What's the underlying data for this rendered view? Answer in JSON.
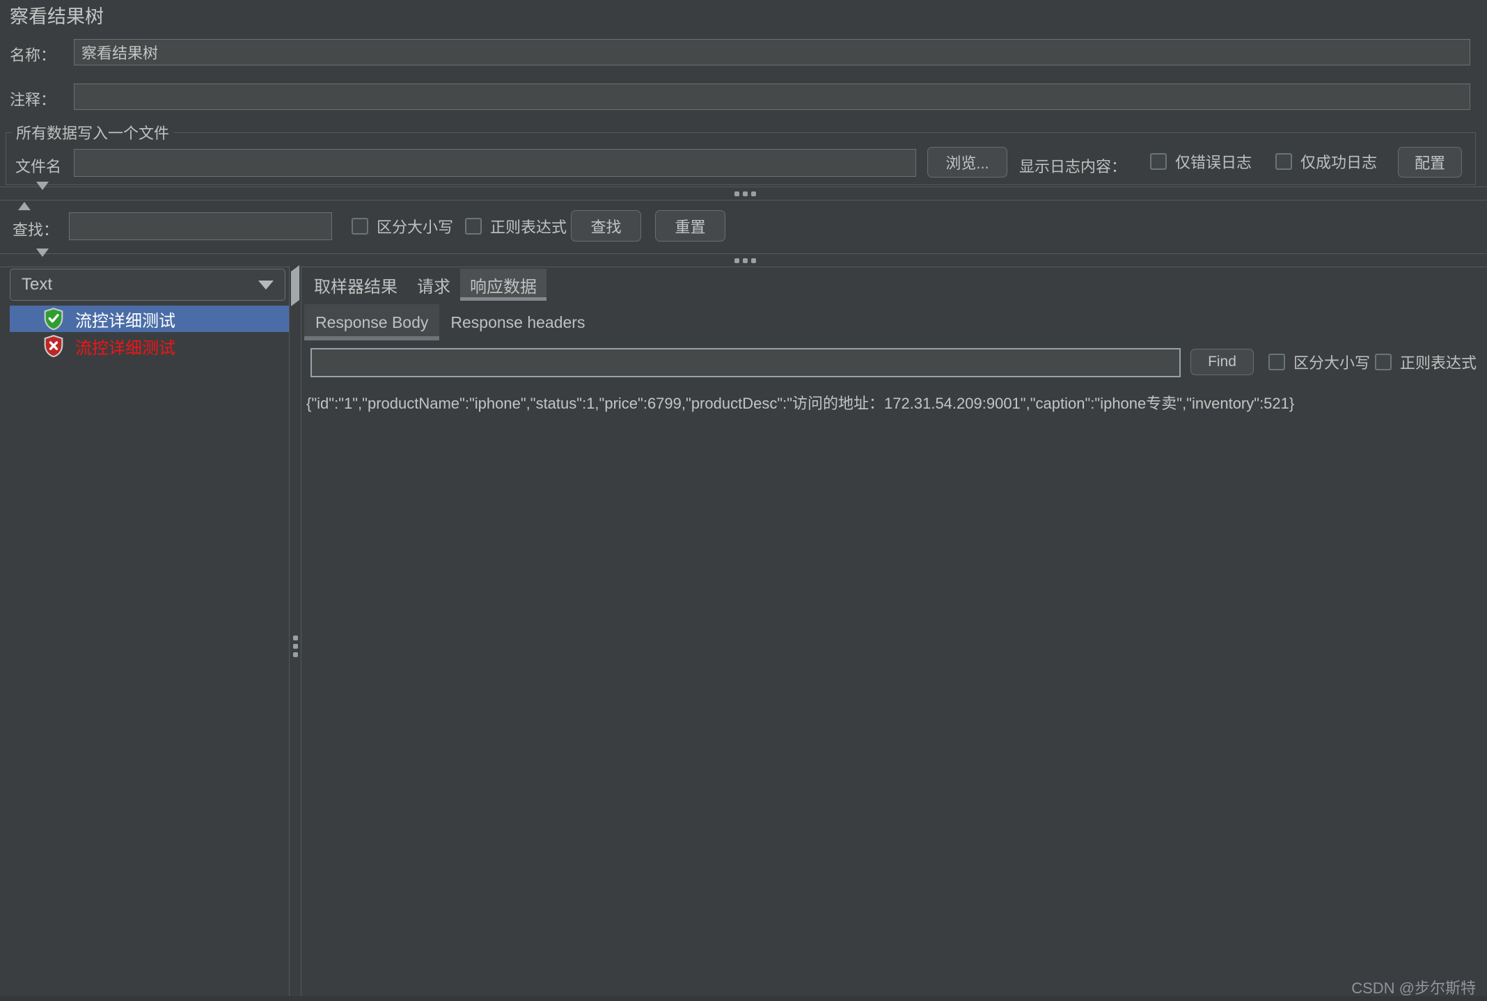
{
  "window": {
    "title": "察看结果树"
  },
  "form": {
    "name_label": "名称：",
    "name_value": "察看结果树",
    "comment_label": "注释：",
    "comment_value": "",
    "file_group": {
      "legend": "所有数据写入一个文件",
      "filename_label": "文件名",
      "filename_value": "",
      "browse_button": "浏览...",
      "log_display_label": "显示日志内容：",
      "errors_only_label": "仅错误日志",
      "success_only_label": "仅成功日志",
      "configure_button": "配置"
    }
  },
  "search_bar": {
    "label": "查找：",
    "value": "",
    "case_sensitive_label": "区分大小写",
    "regex_label": "正则表达式",
    "find_button": "查找",
    "reset_button": "重置"
  },
  "tree_panel": {
    "view_mode": "Text",
    "items": [
      {
        "label": "流控详细测试",
        "status": "success",
        "selected": true
      },
      {
        "label": "流控详细测试",
        "status": "error",
        "selected": false
      }
    ]
  },
  "results_panel": {
    "tabs": [
      {
        "label": "取样器结果"
      },
      {
        "label": "请求"
      },
      {
        "label": "响应数据"
      }
    ],
    "selected_tab": "响应数据",
    "sub_tabs": [
      {
        "label": "Response Body"
      },
      {
        "label": "Response headers"
      }
    ],
    "selected_sub_tab": "Response Body",
    "search": {
      "value": "",
      "find_button": "Find",
      "case_sensitive_label": "区分大小写",
      "regex_label": "正则表达式"
    },
    "response_body": "{\"id\":\"1\",\"productName\":\"iphone\",\"status\":1,\"price\":6799,\"productDesc\":\"访问的地址：172.31.54.209:9001\",\"caption\":\"iphone专卖\",\"inventory\":521}"
  },
  "watermark": "CSDN @步尔斯特",
  "colors": {
    "background": "#3b3e40",
    "selection_blue": "#4a6da7",
    "success_green": "#2f9e2f",
    "error_red": "#f21414",
    "tab_underline": "#82888c",
    "field_bg": "#45494a"
  }
}
